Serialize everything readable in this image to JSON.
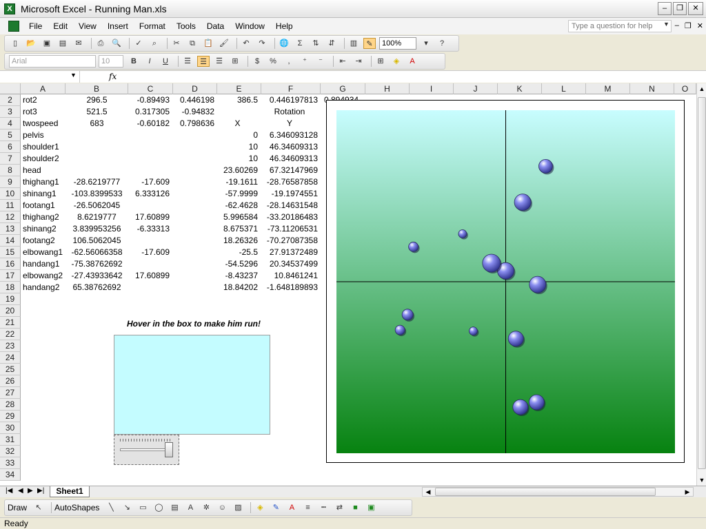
{
  "window": {
    "title": "Microsoft Excel - Running Man.xls",
    "app_icon_letter": "X"
  },
  "menu": [
    "File",
    "Edit",
    "View",
    "Insert",
    "Format",
    "Tools",
    "Data",
    "Window",
    "Help"
  ],
  "help_box": {
    "placeholder": "Type a question for help"
  },
  "toolbar": {
    "zoom": "100%"
  },
  "format_toolbar": {
    "font": "Arial",
    "size": "10"
  },
  "formula_bar": {
    "fx": "fx"
  },
  "columns": [
    "A",
    "B",
    "C",
    "D",
    "E",
    "F",
    "G",
    "H",
    "I",
    "J",
    "K",
    "L",
    "M",
    "N",
    "O"
  ],
  "rows": [
    {
      "n": "2",
      "A": "rot2",
      "B": "296.5",
      "C": "-0.89493",
      "D": "0.446198",
      "E": "386.5",
      "F": "0.446197813",
      "G": "0.894934"
    },
    {
      "n": "3",
      "A": "rot3",
      "B": "521.5",
      "C": "0.317305",
      "D": "-0.94832",
      "E": "",
      "F": "Rotation",
      "G": ""
    },
    {
      "n": "4",
      "A": "twospeed",
      "B": "683",
      "C": "-0.60182",
      "D": "0.798636",
      "E": "X",
      "F": "Y",
      "G": ""
    },
    {
      "n": "5",
      "A": "pelvis",
      "B": "",
      "C": "",
      "D": "",
      "E": "0",
      "F": "6.346093128",
      "G": ""
    },
    {
      "n": "6",
      "A": "shoulder1",
      "B": "",
      "C": "",
      "D": "",
      "E": "10",
      "F": "46.34609313",
      "G": ""
    },
    {
      "n": "7",
      "A": "shoulder2",
      "B": "",
      "C": "",
      "D": "",
      "E": "10",
      "F": "46.34609313",
      "G": ""
    },
    {
      "n": "8",
      "A": "head",
      "B": "",
      "C": "",
      "D": "",
      "E": "23.60269",
      "F": "67.32147969",
      "G": ""
    },
    {
      "n": "9",
      "A": "thighang1",
      "B": "-28.6219777",
      "C": "-17.609",
      "D": "",
      "E": "-19.1611",
      "F": "-28.76587858",
      "G": ""
    },
    {
      "n": "10",
      "A": "shinang1",
      "B": "-103.8399533",
      "C": "6.333126",
      "D": "",
      "E": "-57.9999",
      "F": "-19.1974551",
      "G": ""
    },
    {
      "n": "11",
      "A": "footang1",
      "B": "-26.5062045",
      "C": "",
      "D": "",
      "E": "-62.4628",
      "F": "-28.14631548",
      "G": ""
    },
    {
      "n": "12",
      "A": "thighang2",
      "B": "8.6219777",
      "C": "17.60899",
      "D": "",
      "E": "5.996584",
      "F": "-33.20186483",
      "G": ""
    },
    {
      "n": "13",
      "A": "shinang2",
      "B": "3.839953256",
      "C": "-6.33313",
      "D": "",
      "E": "8.675371",
      "F": "-73.11206531",
      "G": ""
    },
    {
      "n": "14",
      "A": "footang2",
      "B": "106.5062045",
      "C": "",
      "D": "",
      "E": "18.26326",
      "F": "-70.27087358",
      "G": ""
    },
    {
      "n": "15",
      "A": "elbowang1",
      "B": "-62.56066358",
      "C": "-17.609",
      "D": "",
      "E": "-25.5",
      "F": "27.91372489",
      "G": ""
    },
    {
      "n": "16",
      "A": "handang1",
      "B": "-75.38762692",
      "C": "",
      "D": "",
      "E": "-54.5296",
      "F": "20.34537499",
      "G": ""
    },
    {
      "n": "17",
      "A": "elbowang2",
      "B": "-27.43933642",
      "C": "17.60899",
      "D": "",
      "E": "-8.43237",
      "F": "10.8461241",
      "G": ""
    },
    {
      "n": "18",
      "A": "handang2",
      "B": "65.38762692",
      "C": "",
      "D": "",
      "E": "18.84202",
      "F": "-1.648189893",
      "G": ""
    },
    {
      "n": "19"
    },
    {
      "n": "20"
    },
    {
      "n": "21"
    },
    {
      "n": "22"
    },
    {
      "n": "23"
    },
    {
      "n": "24"
    },
    {
      "n": "25"
    },
    {
      "n": "26"
    },
    {
      "n": "27"
    },
    {
      "n": "28"
    },
    {
      "n": "29"
    },
    {
      "n": "30"
    },
    {
      "n": "31"
    },
    {
      "n": "32"
    },
    {
      "n": "33"
    },
    {
      "n": "34"
    }
  ],
  "hover_label": "Hover in the box to make him run!",
  "sheet_tab": "Sheet1",
  "draw_toolbar": {
    "draw": "Draw",
    "autoshapes": "AutoShapes"
  },
  "status": "Ready",
  "chart_data": {
    "type": "scatter",
    "title": "",
    "xlabel": "",
    "ylabel": "",
    "xlim": [
      -100,
      100
    ],
    "ylim": [
      -100,
      100
    ],
    "plot_gradient": [
      "#c8fdff",
      "#078210"
    ],
    "bubble_color": "#8a8ef0",
    "points": [
      {
        "x": 0,
        "y": 6.35,
        "s": 12
      },
      {
        "x": 10,
        "y": 46.35,
        "s": 12
      },
      {
        "x": 23.6,
        "y": 67.32,
        "s": 10
      },
      {
        "x": -19.16,
        "y": -28.77,
        "s": 6
      },
      {
        "x": -57.99,
        "y": -19.2,
        "s": 8
      },
      {
        "x": -62.46,
        "y": -28.15,
        "s": 7
      },
      {
        "x": 5.99,
        "y": -33.2,
        "s": 11
      },
      {
        "x": 8.67,
        "y": -73.11,
        "s": 11
      },
      {
        "x": 18.26,
        "y": -70.27,
        "s": 11
      },
      {
        "x": -25.5,
        "y": 27.91,
        "s": 6
      },
      {
        "x": -54.53,
        "y": 20.35,
        "s": 7
      },
      {
        "x": -8.43,
        "y": 10.85,
        "s": 13
      },
      {
        "x": 18.84,
        "y": -1.65,
        "s": 12
      }
    ]
  }
}
